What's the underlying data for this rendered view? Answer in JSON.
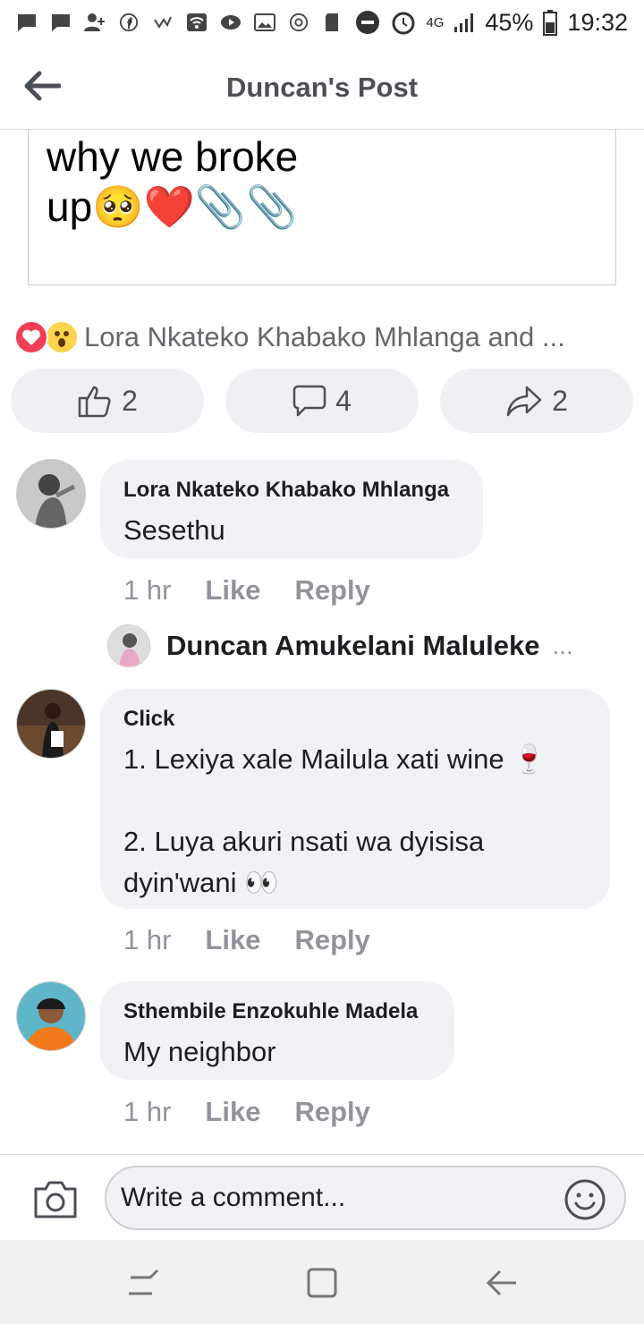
{
  "statusbar": {
    "network": "4G",
    "battery": "45%",
    "time": "19:32"
  },
  "appbar": {
    "title": "Duncan's Post"
  },
  "post": {
    "text": "why we broke\nup🥺❤️📎📎"
  },
  "reactions": {
    "summary": "Lora Nkateko Khabako Mhlanga and ...",
    "icons": [
      "love-icon",
      "wow-icon"
    ]
  },
  "actions": {
    "like_count": "2",
    "comment_count": "4",
    "share_count": "2"
  },
  "comments": [
    {
      "name": "Lora Nkateko Khabako Mhlanga",
      "text": "Sesethu",
      "time": "1 hr",
      "like": "Like",
      "reply": "Reply"
    },
    {
      "name": "Click",
      "text": "1. Lexiya xale Mailula xati wine 🍷\n\n2. Luya akuri nsati wa dyisisa dyin'wani 👀",
      "time": "1 hr",
      "like": "Like",
      "reply": "Reply"
    },
    {
      "name": "Sthembile Enzokuhle Madela",
      "text": "My neighbor",
      "time": "1 hr",
      "like": "Like",
      "reply": "Reply"
    }
  ],
  "reply_preview": {
    "name": "Duncan Amukelani Maluleke",
    "more": "..."
  },
  "composer": {
    "placeholder": "Write a comment..."
  },
  "colors": {
    "accent": "#f33e58",
    "bubble": "#f0f2f5",
    "meta": "#90949c"
  }
}
